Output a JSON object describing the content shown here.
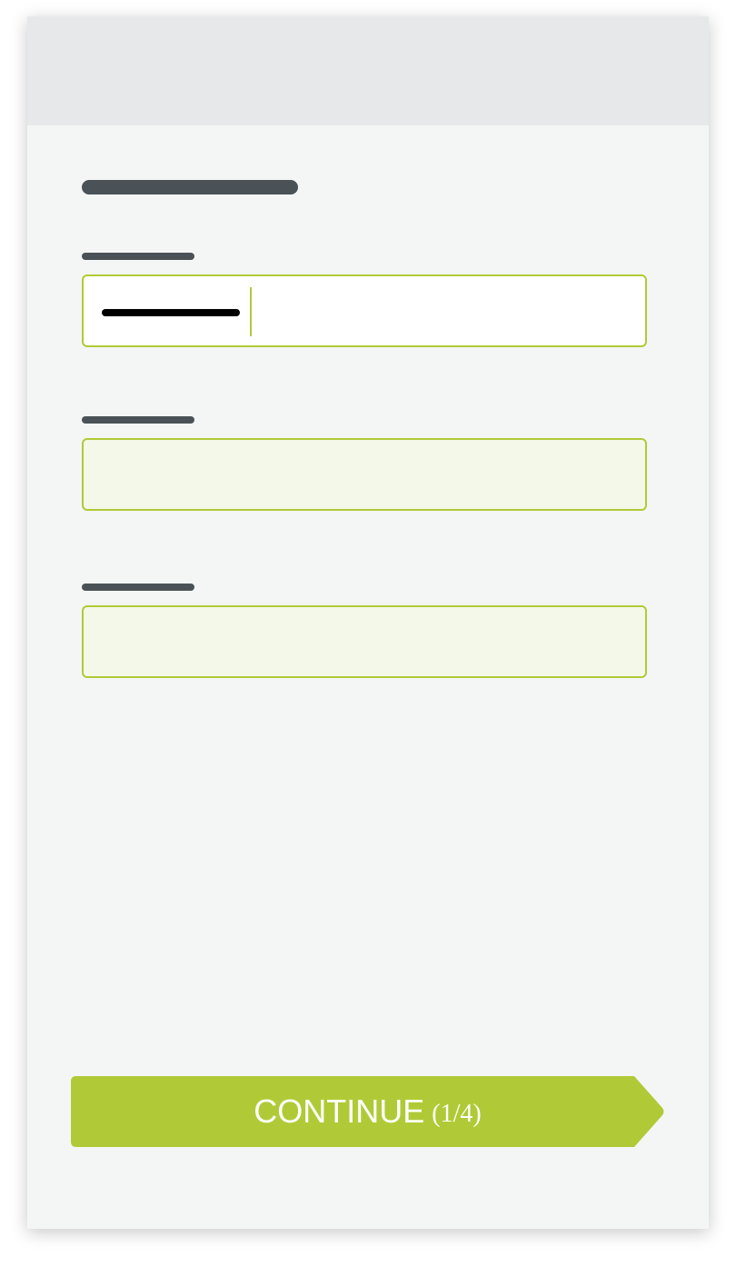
{
  "form": {
    "fields": [
      {
        "state": "active",
        "has_value": true
      },
      {
        "state": "inactive",
        "has_value": false
      },
      {
        "state": "inactive",
        "has_value": false
      }
    ]
  },
  "continue_button": {
    "label": "CONTINUE",
    "step": "(1/4)"
  },
  "colors": {
    "accent": "#b0ca37",
    "card_background": "#f4f6f5",
    "header_background": "#e7e8e9",
    "placeholder_bar": "#4a5257",
    "inactive_field_background": "#f4f8e8"
  }
}
